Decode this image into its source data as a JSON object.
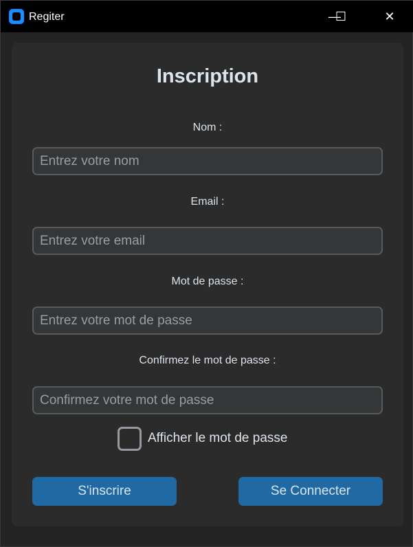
{
  "window": {
    "title": "Regiter",
    "minimize": "—",
    "maximize": "☐",
    "close": "✕"
  },
  "form": {
    "heading": "Inscription",
    "name_label": "Nom :",
    "name_placeholder": "Entrez votre nom",
    "email_label": "Email :",
    "email_placeholder": "Entrez votre email",
    "password_label": "Mot de passe :",
    "password_placeholder": "Entrez votre mot de passe",
    "confirm_label": "Confirmez le mot de passe :",
    "confirm_placeholder": "Confirmez votre mot de passe",
    "show_password_label": "Afficher le mot de passe",
    "show_password_checked": false,
    "register_button": "S'inscrire",
    "login_button": "Se Connecter"
  },
  "colors": {
    "accent": "#1f6aa5",
    "background": "#242424",
    "frame": "#2b2b2b"
  }
}
